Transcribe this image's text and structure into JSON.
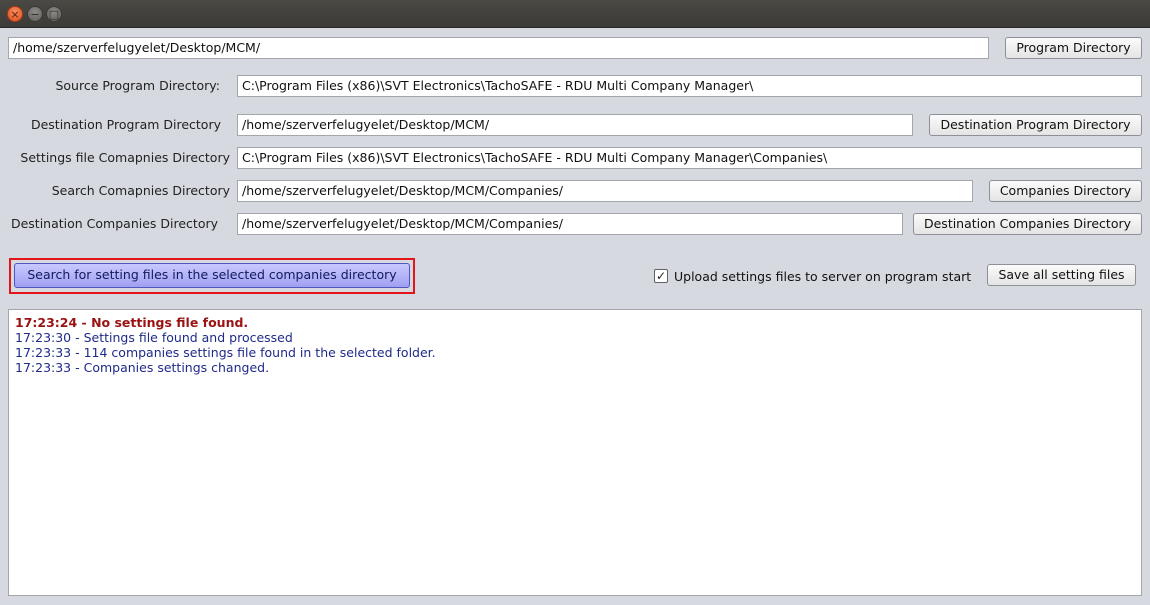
{
  "window": {
    "close_glyph": "×",
    "min_glyph": "−",
    "max_glyph": "□"
  },
  "program_dir": {
    "value": "/home/szerverfelugyelet/Desktop/MCM/",
    "button": "Program Directory"
  },
  "source_program": {
    "label": "Source Program Directory:",
    "value": "C:\\Program Files (x86)\\SVT Electronics\\TachoSAFE - RDU Multi Company Manager\\"
  },
  "destination_program": {
    "label": "Destination Program Directory",
    "value": "/home/szerverfelugyelet/Desktop/MCM/",
    "button": "Destination Program Directory"
  },
  "settings_companies": {
    "label": "Settings file Comapnies Directory",
    "value": "C:\\Program Files (x86)\\SVT Electronics\\TachoSAFE - RDU Multi Company Manager\\Companies\\"
  },
  "search_companies": {
    "label": "Search Comapnies Directory",
    "value": "/home/szerverfelugyelet/Desktop/MCM/Companies/",
    "button": "Companies Directory"
  },
  "destination_companies": {
    "label": "Destination Companies Directory",
    "value": "/home/szerverfelugyelet/Desktop/MCM/Companies/",
    "button": "Destination Companies Directory"
  },
  "actions": {
    "search_button": "Search for setting files in the selected companies directory",
    "upload_checkbox_label": "Upload settings files to server on program start",
    "upload_checked": true,
    "check_glyph": "✓",
    "save_button": "Save all setting files"
  },
  "log": [
    {
      "text": "17:23:24 - No settings file found.",
      "level": "error"
    },
    {
      "text": "17:23:30 - Settings file found and processed",
      "level": "info"
    },
    {
      "text": "17:23:33 - 114 companies settings file found in the selected folder.",
      "level": "info"
    },
    {
      "text": "17:23:33 - Companies settings changed.",
      "level": "info"
    }
  ],
  "colors": {
    "error": "#9a1212",
    "info": "#1f2a8a",
    "highlight": "#e4141b",
    "primary_button": "#a0a0f2"
  }
}
